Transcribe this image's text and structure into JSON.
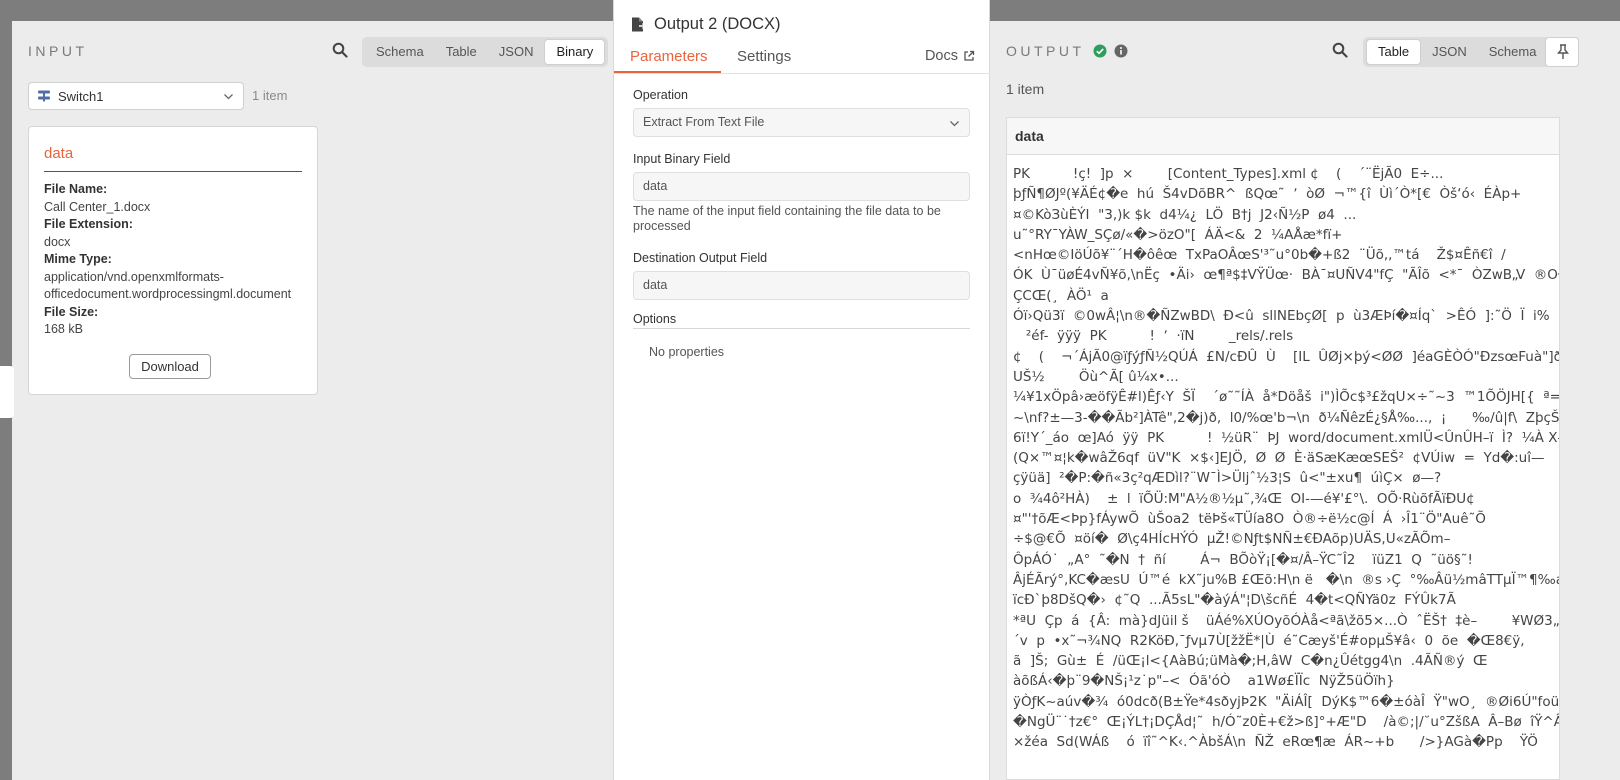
{
  "input": {
    "title": "INPUT",
    "view_options": [
      "Schema",
      "Table",
      "JSON",
      "Binary"
    ],
    "active_view": "Binary",
    "node_select_value": "Switch1",
    "item_count": "1 item",
    "card": {
      "title": "data",
      "file_name_label": "File Name:",
      "file_name": "Call Center_1.docx",
      "file_extension_label": "File Extension:",
      "file_extension": "docx",
      "mime_type_label": "Mime Type:",
      "mime_type_line1": "application/vnd.openxmlformats-",
      "mime_type_line2": "officedocument.wordprocessingml.document",
      "file_size_label": "File Size:",
      "file_size": "168 kB",
      "download_label": "Download"
    }
  },
  "node": {
    "title": "Output 2 (DOCX)",
    "tabs": [
      "Parameters",
      "Settings"
    ],
    "active_tab": "Parameters",
    "docs_label": "Docs",
    "operation_label": "Operation",
    "operation_value": "Extract From Text File",
    "input_binary_label": "Input Binary Field",
    "input_binary_value": "data",
    "input_binary_hint": "The name of the input field containing the file data to be processed",
    "destination_label": "Destination Output Field",
    "destination_value": "data",
    "options_label": "Options",
    "no_properties": "No properties"
  },
  "output": {
    "title": "OUTPUT",
    "view_options": [
      "Table",
      "JSON",
      "Schema"
    ],
    "active_view": "Table",
    "item_count": "1 item",
    "column_header": "data",
    "cell_text": "PK          !ç!  ]p  ×        [Content_Types].xml ¢    (    ´¨ËjÃ0  E÷...\nþƒÑ¶ØJº(¥ÄÉ¢�e  hú  Š4vDõBR^  ßQœ˜  ʼ  òØ  ¬™{î  Ùì´Ò*[€  Òš‘ó‹  ÉÀp+\n¤©KòЗùÈÝI  \"3,)k $k  d4¼¿  LÖ  B†j  J2‹Ñ½P  ø4  ...\nu˜°RY¯YÀW_SÇø/«�>özO\"[  ÁÄ<&  2  ¼AÅæ*fï+\n<nHœ©IöÚõ¥¨´H�ôêœ  TxPaOÂœS'³˜u°0b�+ß2  ¨Üõ,,™tá    Ž$¤Êñ€î  /\nÓK  Ù¯üøÉ4vÑ¥õ,\\nËç  •Äi›  œ¶ª$‡VŸÜœ·  BÀ¯¤UÑV4\"fÇ  \"ÃÎõ  <*¯  ÒZwB„V  ®OÐøv\nÇCŒ(¸  ÀÖ¹  a\nÓï›Qü3ï  ©0wÂ¦\\n®�ÑZwBD\\  Ð<û  sllNEbçØ[  p  ù3ÆÞí�¤Íq`  >ÊÓ  ]:˜Ö  Ï  i%\n   ²éf-  ÿÿÿ  PK          !  ʼ  ·ïN        _rels/.rels\n¢    (    ¬´ÁjÃ0@ïƒýƒÑ½QÚÁ  £N/cÐÛ  Ù    [IL  ÛØj×þý<ØØ  ]éaGÈÒÓ\"ÐzsœFuà\"]ð  –\nUŠ½        Öù^Ã[ û¼x•...\n¼¥1xÖpâ›æöfÿÊ#l)Êƒ‹Y  ŠÏ    ´ø˜˜ÍÀ  å*Döåš  i\")ÌÕc$³£žqU×÷˜~3  ™1ÕÖJH[{  ª=E¾†  °Î\n~\\nf?±—3-��Ãb²]ÀTê\",2�j)ð,  l0/%œ'b¬\\n  ð¼ÑêzÉ¿§Å‰...,  ¡      ‰/û|f\\  ZþçŠæ  ?\n6ï!Y´_áo  œ]Aó  ÿÿ  PK          !  ½üR¨  ÞJ  word/document.xmlÜ<ÛnÛH–ï  Ì?  ¼À X–\n(Q×™¤¦k�wâŽ6qf  üV\"K  ×$‹]EJÖ,  Ø  Ø  È·äSæKæœSEŠ²  ¢VÚiw  =  Yd�:uî—\nçÿüä]  ²�P:�ñ«3ç²qÆDìl?¨W¯Ì>Üljˆ½3¦S  û<\"±xu¶  úìÇ×  ø—?\no  ¾4ô²HÀ)    ±  l  ïÕÜ:M\"A½®½µ˜,¾Œ  OI-—é¥'£°\\.  OÕ·RùõfÃïÐU¢\n¤\"'†õÆ<Þp}fÁywÕ  ùŠoa2  tëÞš«TÜía8O  Ò®÷ë½c@Í  Á  ›Î1¨Ö\"Auê˜Õ\n÷$@€Õ  ¤öí�  Ø\\ç4HÍcHÝÓ  µŽ!©Nƒt$NÑ±€ÐAõp)UÄS,U«zÃÕm–\nÔpÁÓ˙  „A°  ˜�N  †  ñí        Á¬  BÕòŸ¡[�¤/Â–ŸC˜Î2    ïüZ1  Q  ˜üö§˜!\nÂjÉÃrý°,KC�æsU  Ú™é  kX˜ju%B £Œõ:H\\n ë   �\\n  ®s ›Ç  °‰Âü½mâTTµÏ™¶‰aÃ  `  ô-\nïcÐ`þ8DšQ�›  ¢˜Q  ...Ã5sL\"�àýÁ\"¦D\\šcñÉ  4�t<QÑYä0z  FÝÛk7Ã\n*ªU  Çp  á  {Â:  mà}dJüil š    üÁé%XÚOyõÓÀå<ªã\\žõ5×...Ò  ˆËŠ†  ‡è–        ¥WØ3„)žF\n´v  p  •x˜¬¾NQ  R2KöÐ,¯ƒvµ7Ù[žžË*|Ù  é˜Cæyš'É#opµŠ¥â‹  0  õe  �Œ8€ÿ,\nã  ]Š;  Gù±  É  /üŒ¡l<{AàBú;üMà�;H,âW  C�n¿Ûétgg4\\n  .4ÃÑ®ý  Œ\nàõßÁ‹�þ¨9�NŠ¡¹z˙p\"–<  Óã'óÒ    a1Wø£ÏÏc  NÿŽ5üÖïh}\nÿÒƒK~aúv�¾  ó0dcð(B±Ÿe*4sðyjÞ2K  \"ÄiÁÎ[  DýK$™6�±óàÎ  Ÿ\"wO¸  ®Øi6Ú\"foüô  Ez\n�NgÜ¨˙†z€°  Œ¡ÝL†¡DÇÅd¦˜  h/Ó˜z0È+€ž>ß]°+Æ\"D    /à©;|/˘u°ZšßA  Â–Bø  îŸ^Â‹\n×žéa  Sd(WÁß    ó  ïî˜^K‹.^ÀbšÁ\\n  ÑŽ  eRœ¶æ  ÁR~+b      />}AGà�Pp    ŸÖ"
  },
  "colors": {
    "accent": "#e9643c",
    "success": "#2e9e5c"
  },
  "icons": [
    "search-icon",
    "switch-node-icon",
    "chevron-down-icon",
    "file-export-icon",
    "external-link-icon",
    "check-circle-icon",
    "info-circle-icon",
    "pin-icon"
  ]
}
